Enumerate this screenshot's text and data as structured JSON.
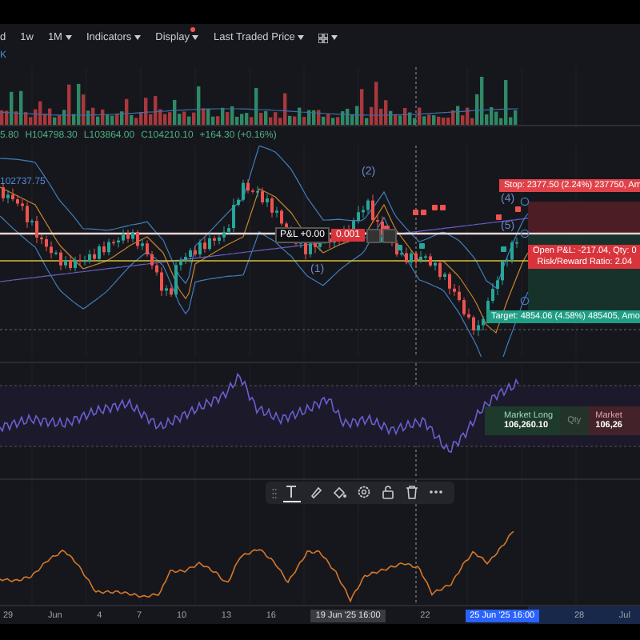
{
  "toolbar": [
    {
      "kind": "text",
      "label": "d",
      "dropdown": false,
      "alert": false
    },
    {
      "kind": "text",
      "label": "1w",
      "dropdown": false,
      "alert": false
    },
    {
      "kind": "text",
      "label": "1M",
      "dropdown": true,
      "alert": false
    },
    {
      "kind": "text",
      "label": "Indicators",
      "dropdown": true,
      "alert": false
    },
    {
      "kind": "text",
      "label": "Display",
      "dropdown": true,
      "alert": true
    },
    {
      "kind": "text",
      "label": "Last Traded Price",
      "dropdown": true,
      "alert": false
    },
    {
      "kind": "layout",
      "dropdown": true,
      "alert": false
    }
  ],
  "symbol_tag": "K",
  "ohlc": [
    "5.80",
    "H104798.30",
    "L103864.00",
    "C104210.10",
    "+164.30 (+0.16%)"
  ],
  "main_chart": {
    "price_label": "102737.75",
    "waves": [
      {
        "label": "(1)"
      },
      {
        "label": "(2)"
      },
      {
        "label": "(4)"
      },
      {
        "label": "(5)"
      }
    ],
    "pnl": {
      "label": "P&L +0.00",
      "qty": "0.001"
    },
    "stop": "Stop: 2377.50 (2.24%) 237750, Am",
    "open_pnl": "Open P&L: -217.04, Qty: 0",
    "risk_reward": "Risk/Reward Ratio: 2.04",
    "target": "Target: 4854.06 (4.58%) 485405, Amo"
  },
  "order_panel": {
    "long_label": "Market Long",
    "long_price": "106,260.10",
    "qty": "Qty",
    "short_label": "Market",
    "short_price": "106,26"
  },
  "drawing_toolbar": [
    {
      "kind": "text",
      "selected": true
    },
    {
      "kind": "brush",
      "selected": false
    },
    {
      "kind": "fill",
      "selected": false
    },
    {
      "kind": "settings",
      "selected": false
    },
    {
      "kind": "lock",
      "selected": false
    },
    {
      "kind": "trash",
      "selected": false
    },
    {
      "kind": "more",
      "selected": false
    }
  ],
  "time_axis": [
    {
      "kind": "tick",
      "label": "29"
    },
    {
      "kind": "tick",
      "label": "Jun"
    },
    {
      "kind": "tick",
      "label": "4"
    },
    {
      "kind": "tick",
      "label": "7"
    },
    {
      "kind": "tick",
      "label": "10"
    },
    {
      "kind": "tick",
      "label": "13"
    },
    {
      "kind": "tick",
      "label": "16"
    },
    {
      "kind": "crosshair",
      "label": "19 Jun '25  16:00"
    },
    {
      "kind": "tick",
      "label": "22"
    },
    {
      "kind": "selection",
      "label": "25 Jun '25  16:00"
    },
    {
      "kind": "tick",
      "label": "28"
    },
    {
      "kind": "tick",
      "label": "Jul"
    }
  ]
}
